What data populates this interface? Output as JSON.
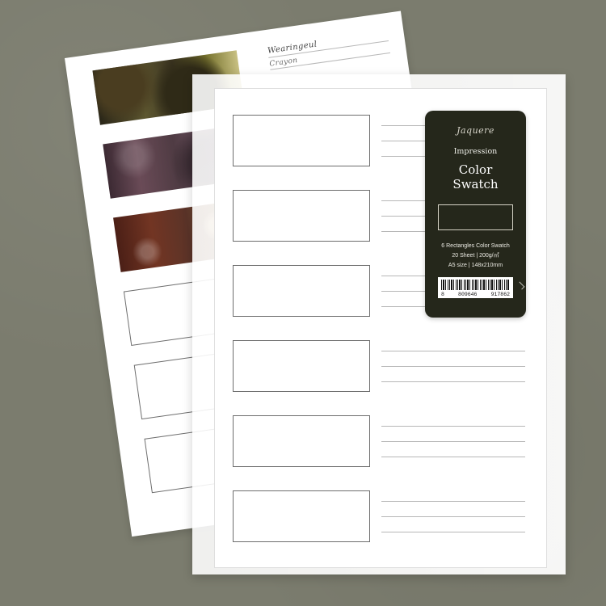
{
  "page": {
    "background_color": "#7b7c6e"
  },
  "back_sheet": {
    "heading_lines": [
      {
        "text": "Wearingeul"
      },
      {
        "text": "Crayon"
      }
    ],
    "swatches": [
      {
        "filled": true,
        "color_hint": "#5b4f2d"
      },
      {
        "filled": true,
        "color_hint": "#5e4750"
      },
      {
        "filled": true,
        "color_hint": "#6e3b2b"
      },
      {
        "filled": false
      },
      {
        "filled": false
      },
      {
        "filled": false
      }
    ]
  },
  "label": {
    "brand": "Jaquere",
    "line1": "Impression",
    "product_line1": "Color",
    "product_line2": "Swatch",
    "spec_line1": "6 Rectangles Color Swatch",
    "spec_line2": "20 Sheet | 200g/㎡",
    "spec_line3": "A5 size | 148x210mm",
    "barcode_digits": [
      "8",
      "809646",
      "917862"
    ],
    "colors": {
      "label_bg": "#25271b",
      "label_text": "#f2f2ec"
    }
  },
  "front_sheet": {
    "rows": [
      {
        "label": ""
      },
      {
        "label": ""
      },
      {
        "label": ""
      },
      {
        "label": ""
      },
      {
        "label": ""
      },
      {
        "label": ""
      }
    ]
  }
}
